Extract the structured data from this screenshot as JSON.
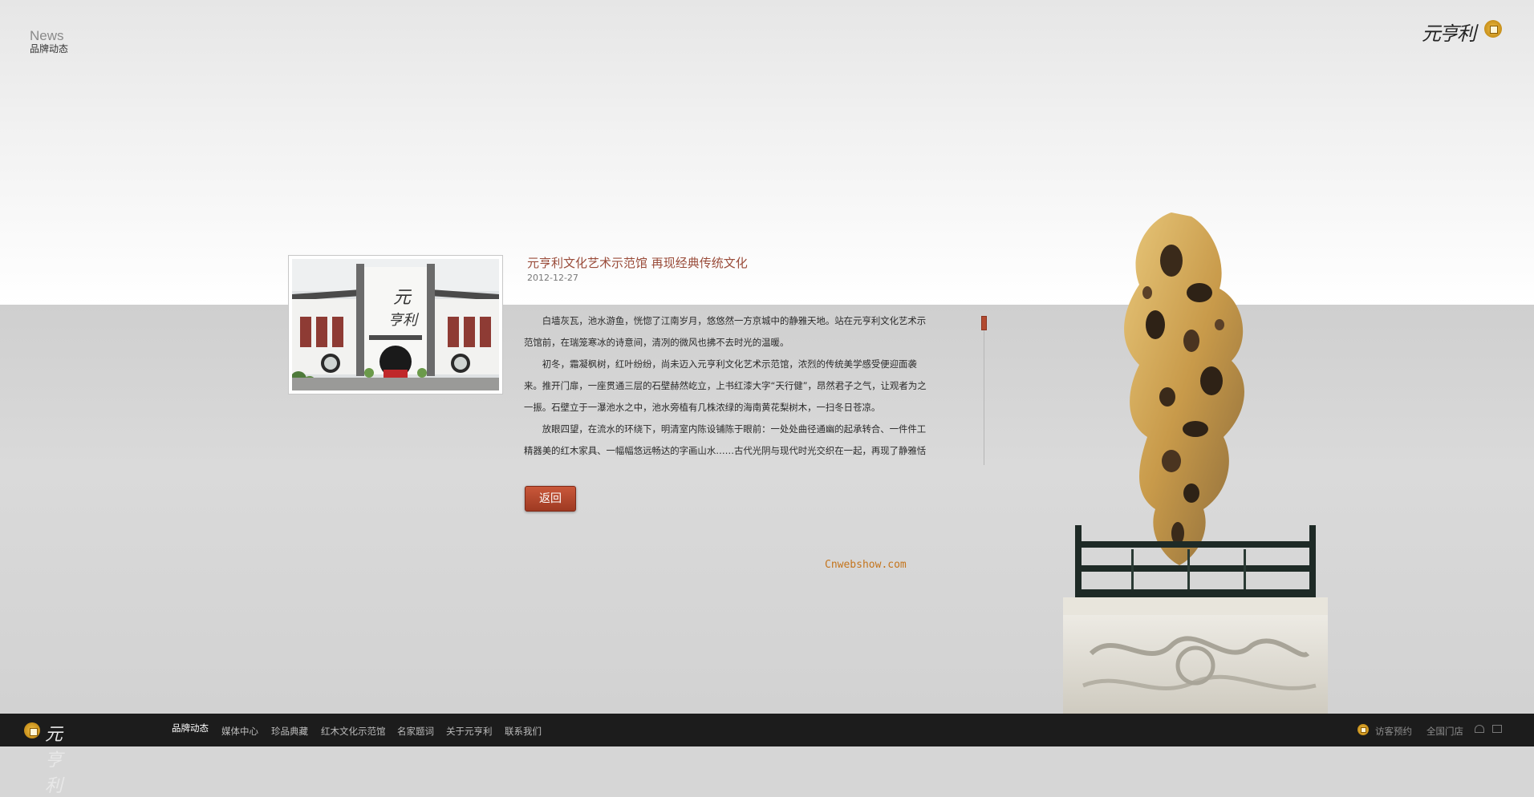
{
  "header": {
    "section_en": "News",
    "section_cn": "品牌动态",
    "logo_text": "元亨利"
  },
  "article": {
    "title": "元亨利文化艺术示范馆 再现经典传统文化",
    "date": "2012-12-27",
    "paragraphs": [
      "　　白墙灰瓦，池水游鱼，恍惚了江南岁月，悠悠然一方京城中的静雅天地。站在元亨利文化艺术示范馆前，在瑞笼寒冰的诗意间，清冽的微风也拂不去时光的温暖。",
      "　　初冬，霜凝枫树，红叶纷纷，尚未迈入元亨利文化艺术示范馆，浓烈的传统美学感受便迎面袭来。推开门扉，一座贯通三层的石壁赫然屹立，上书红漆大字“天行健”，昂然君子之气，让观者为之一振。石壁立于一瀑池水之中，池水旁植有几株浓绿的海南黄花梨树木，一扫冬日苍凉。",
      "　　放眼四望，在流水的环绕下，明清室内陈设铺陈于眼前：一处处曲径通幽的起承转合、一件件工精器美的红木家具、一幅幅悠远畅达的字画山水……古代光阴与现代时光交织在一起，再现了静雅恬淡的"
    ],
    "back_label": "返回"
  },
  "watermark": "Cnwebshow.com",
  "footer": {
    "logo_text": "元亨利",
    "nav": [
      {
        "label": "品牌动态",
        "active": true
      },
      {
        "label": "媒体中心"
      },
      {
        "label": "珍品典藏"
      },
      {
        "label": "红木文化示范馆"
      },
      {
        "label": "名家题词"
      },
      {
        "label": "关于元亨利"
      },
      {
        "label": "联系我们"
      }
    ],
    "visit_label": "访客预约",
    "stores_label": "全国门店"
  },
  "colors": {
    "accent": "#9a4c3a",
    "button": "#b24a30",
    "footer_bg": "#1c1c1c",
    "watermark": "#c4741c"
  }
}
